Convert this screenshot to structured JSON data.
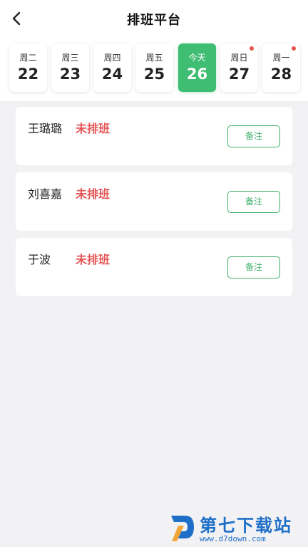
{
  "header": {
    "title": "排班平台",
    "back_icon": "chevron-left-icon"
  },
  "dates": [
    {
      "dow": "周二",
      "day": "22",
      "active": false,
      "dot": false
    },
    {
      "dow": "周三",
      "day": "23",
      "active": false,
      "dot": false
    },
    {
      "dow": "周四",
      "day": "24",
      "active": false,
      "dot": false
    },
    {
      "dow": "周五",
      "day": "25",
      "active": false,
      "dot": false
    },
    {
      "dow": "今天",
      "day": "26",
      "active": true,
      "dot": false
    },
    {
      "dow": "周日",
      "day": "27",
      "active": false,
      "dot": true
    },
    {
      "dow": "周一",
      "day": "28",
      "active": false,
      "dot": true
    }
  ],
  "staff": [
    {
      "name": "王璐璐",
      "status": "未排班",
      "note_label": "备注"
    },
    {
      "name": "刘喜嘉",
      "status": "未排班",
      "note_label": "备注"
    },
    {
      "name": "于波",
      "status": "未排班",
      "note_label": "备注"
    }
  ],
  "watermark": {
    "title": "第七下载站",
    "url": "www.d7down.com"
  },
  "colors": {
    "accent": "#3fbd72",
    "status_red": "#e55454",
    "note_border": "#3fae6a",
    "dot_red": "#e5534b",
    "watermark_blue": "#1e6fc7",
    "background": "#f2f2f4"
  }
}
